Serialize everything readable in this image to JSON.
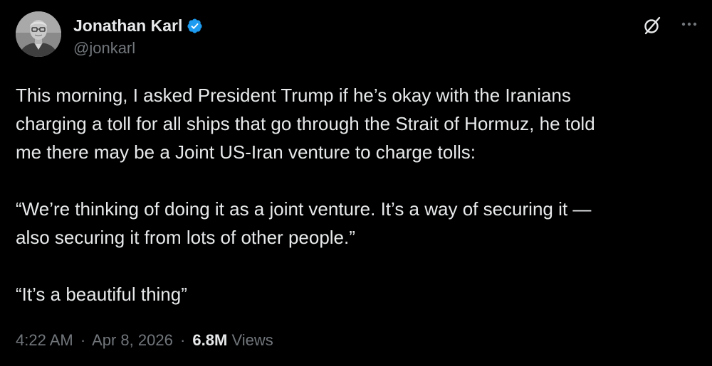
{
  "author": {
    "display_name": "Jonathan Karl",
    "handle": "@jonkarl",
    "verified": true,
    "verified_color": "#1d9bf0"
  },
  "header_actions": {
    "grok_icon": "grok-icon",
    "more_icon": "more-icon"
  },
  "tweet": {
    "paragraphs": [
      [
        "This morning, I asked President Trump if he’s okay with the Iranians",
        "charging a toll for all ships that go through the Strait of Hormuz, he told",
        "me there may be a Joint US-Iran venture to charge tolls:"
      ],
      [
        "“We’re thinking of doing it as a joint venture. It’s a way of securing it —",
        "also securing it from lots of other people.”"
      ],
      [
        "“It’s a beautiful thing”"
      ]
    ]
  },
  "meta": {
    "time": "4:22 AM",
    "separator": "·",
    "date": "Apr 8, 2026",
    "views_count": "6.8M",
    "views_label": "Views"
  },
  "colors": {
    "background": "#000000",
    "text_primary": "#e7e9ea",
    "text_secondary": "#71767b",
    "accent": "#1d9bf0"
  }
}
